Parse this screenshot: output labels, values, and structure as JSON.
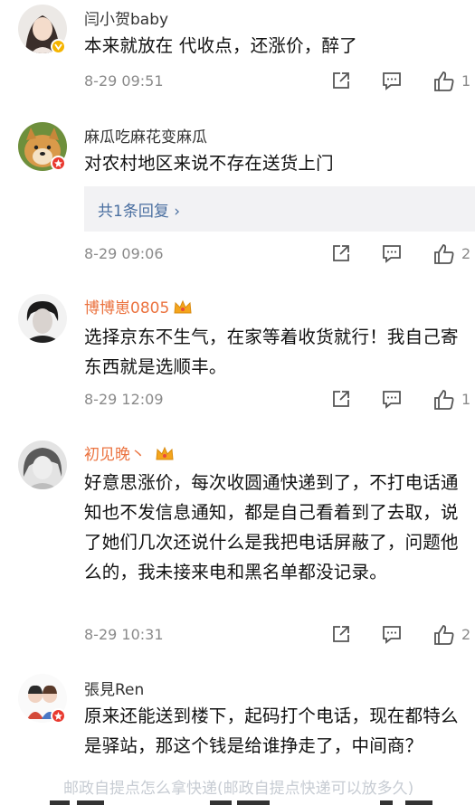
{
  "comments": [
    {
      "name": "闫小贺baby",
      "text": "本来就放在 代收点，还涨价，醉了",
      "time": "8-29 09:51",
      "likes": "1",
      "badge_color": "#f5b400"
    },
    {
      "name": "麻瓜吃麻花变麻瓜",
      "text": "对农村地区来说不存在送货上门",
      "reply_link": "共1条回复 ›",
      "time": "8-29 09:06",
      "likes": "2",
      "badge_color": "#e9392f"
    },
    {
      "name": "博博崽0805",
      "text": "选择京东不生气，在家等着收货就行！我自己寄东西就是选顺丰。",
      "time": "8-29 12:09",
      "likes": "1",
      "vip": true
    },
    {
      "name": "初见晚丶",
      "text": "好意思涨价，每次收圆通快递到了，不打电话通知也不发信息通知，都是自己看着到了去取，说了她们几次还说什么是我把电话屏蔽了，问题他么的，我未接来电和黑名单都没记录。",
      "time": "8-29 10:31",
      "likes": "2",
      "vip": true
    },
    {
      "name": "張見Ren",
      "text": "原来还能送到楼下，起码打个电话，现在都特么是驿站，那这个钱是给谁挣走了，中间商？",
      "badge_color": "#e9392f"
    }
  ],
  "icons": {
    "share": "share-icon",
    "comment": "comment-icon",
    "like": "thumbs-up-icon"
  },
  "watermark": "邮政自提点怎么拿快递(邮政自提点快递可以放多久)",
  "colors": {
    "vip_name": "#eb7340",
    "reply_link": "#4a6fa0",
    "meta_gray": "#8a8a8a"
  }
}
